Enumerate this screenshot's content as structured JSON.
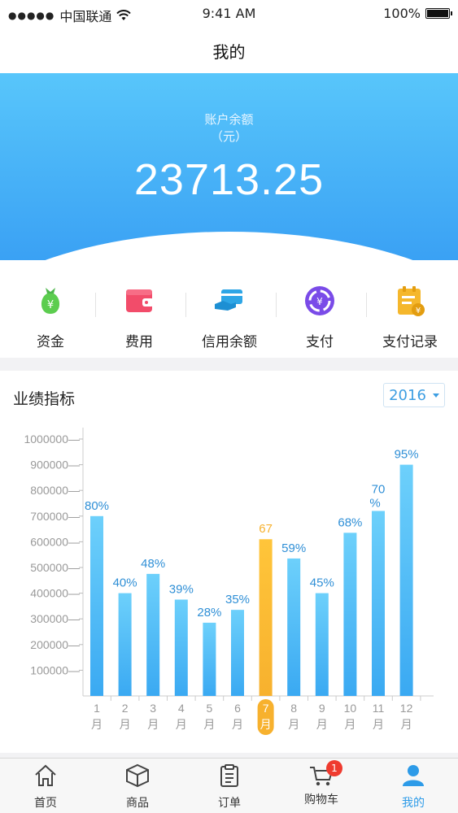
{
  "status_bar": {
    "carrier": "中国联通",
    "time": "9:41 AM",
    "battery": "100%"
  },
  "nav": {
    "title": "我的"
  },
  "account": {
    "label_line1": "账户余额",
    "label_line2": "（元）",
    "balance": "23713.25"
  },
  "quick_menu": [
    {
      "label": "资金",
      "icon": "money-bag-icon"
    },
    {
      "label": "费用",
      "icon": "wallet-icon"
    },
    {
      "label": "信用余额",
      "icon": "credit-card-icon"
    },
    {
      "label": "支付",
      "icon": "payment-icon"
    },
    {
      "label": "支付记录",
      "icon": "payment-record-icon"
    }
  ],
  "performance": {
    "title": "业绩指标",
    "year": "2016"
  },
  "chart_data": {
    "type": "bar",
    "categories": [
      "1月",
      "2月",
      "3月",
      "4月",
      "5月",
      "6月",
      "7月",
      "8月",
      "9月",
      "10月",
      "11月",
      "12月"
    ],
    "values": [
      700000,
      400000,
      475000,
      375000,
      285000,
      335000,
      610000,
      535000,
      400000,
      635000,
      720000,
      900000
    ],
    "data_labels": [
      "80%",
      "40%",
      "48%",
      "39%",
      "28%",
      "35%",
      "67",
      "59%",
      "45%",
      "68%",
      "70%",
      "95%"
    ],
    "highlighted_category": "7月",
    "yticks": [
      100000,
      200000,
      300000,
      400000,
      500000,
      600000,
      700000,
      800000,
      900000,
      1000000
    ],
    "ylim": [
      0,
      1000000
    ],
    "colors": {
      "bar": "#3aa9f2",
      "bar_top": "#6dd0fb",
      "highlight": "#f7b12e",
      "label": "#2f8fd6"
    }
  },
  "tabs": [
    {
      "label": "首页",
      "icon": "home-icon"
    },
    {
      "label": "商品",
      "icon": "box-icon"
    },
    {
      "label": "订单",
      "icon": "clipboard-icon"
    },
    {
      "label": "购物车",
      "icon": "cart-icon",
      "badge": "1"
    },
    {
      "label": "我的",
      "icon": "user-icon",
      "active": true
    }
  ]
}
